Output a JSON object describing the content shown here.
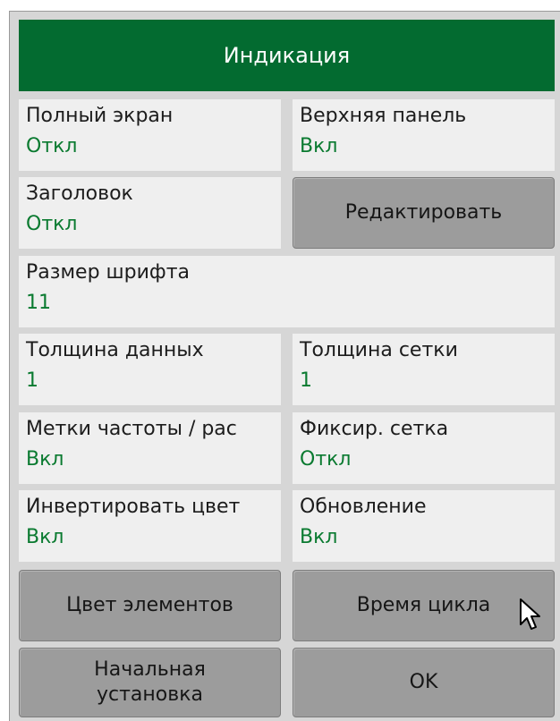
{
  "title": "Индикация",
  "items": [
    {
      "label": "Полный экран",
      "value": "Откл"
    },
    {
      "label": "Верхняя панель",
      "value": "Вкл"
    },
    {
      "label": "Заголовок",
      "value": "Откл"
    },
    {
      "label": "Размер шрифта",
      "value": "11"
    },
    {
      "label": "Толщина данных",
      "value": "1"
    },
    {
      "label": "Толщина сетки",
      "value": "1"
    },
    {
      "label": "Метки частоты / рас",
      "value": "Вкл"
    },
    {
      "label": "Фиксир. сетка",
      "value": "Откл"
    },
    {
      "label": "Инвертировать цвет",
      "value": "Вкл"
    },
    {
      "label": "Обновление",
      "value": "Вкл"
    }
  ],
  "buttons": {
    "edit": "Редактировать",
    "element_color": "Цвет элементов",
    "cycle_time": "Время цикла",
    "reset_line1": "Начальная",
    "reset_line2": "установка",
    "ok": "OK"
  },
  "colors": {
    "header_bg": "#036b30",
    "value_text": "#0a7a30",
    "button_bg": "#9c9c9c",
    "cell_bg": "#efefef"
  },
  "icons": {
    "cursor": "mouse-pointer-icon"
  }
}
